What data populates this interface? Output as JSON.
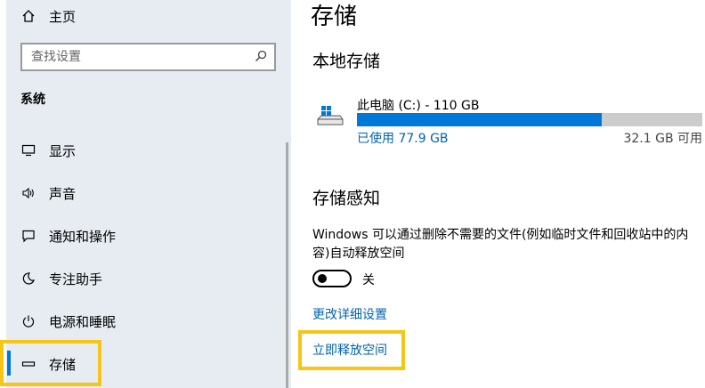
{
  "sidebar": {
    "home_label": "主页",
    "search_placeholder": "查找设置",
    "section_label": "系统",
    "items": [
      {
        "label": "显示"
      },
      {
        "label": "声音"
      },
      {
        "label": "通知和操作"
      },
      {
        "label": "专注助手"
      },
      {
        "label": "电源和睡眠"
      },
      {
        "label": "存储"
      }
    ],
    "selected_item": "存储"
  },
  "main": {
    "title": "存储",
    "local_storage_heading": "本地存储",
    "drive": {
      "name": "此电脑 (C:) - 110 GB",
      "used_label": "已使用 77.9 GB",
      "free_label": "32.1 GB 可用",
      "used_fraction": 0.708
    },
    "storage_sense_heading": "存储感知",
    "storage_sense_description": "Windows 可以通过删除不需要的文件(例如临时文件和回收站中的内容)自动释放空间",
    "toggle_state_label": "关",
    "toggle_on": false,
    "change_settings_link": "更改详细设置",
    "free_up_link": "立即释放空间"
  },
  "colors": {
    "accent": "#0078d7",
    "link": "#0063b1",
    "highlight": "#f5c518",
    "sidebar_bg": "#e6ecf2",
    "bar_track": "#cccccc"
  }
}
